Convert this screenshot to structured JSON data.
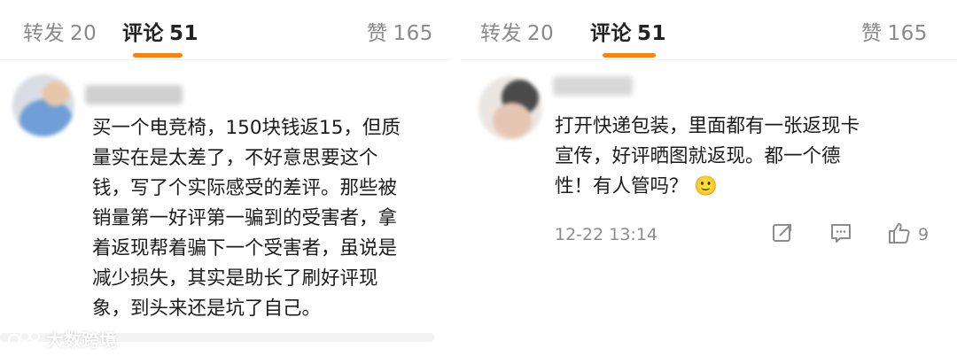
{
  "tabs": [
    {
      "label": "转发",
      "count": "20"
    },
    {
      "label": "评论",
      "count": "51"
    },
    {
      "label": "赞",
      "count": "165"
    }
  ],
  "accent_color": "#ff8200",
  "comments": [
    {
      "lines": [
        "买一个电竞椅，150块钱返15，但质",
        "量实在是太差了，不好意思要这个",
        "钱，写了个实际感受的差评。那些被",
        "销量第一好评第一骗到的受害者，拿",
        "着返现帮着骗下一个受害者，虽说是",
        "减少损失，其实是助长了刷好评现",
        "象，到头来还是坑了自己。"
      ]
    },
    {
      "lines": [
        "打开快递包装，里面都有一张返现卡",
        "宣传，好评晒图就返现。都一个德",
        "性！有人管吗？"
      ],
      "emoji": "🙂",
      "timestamp": "12-22 13:14",
      "like_count": "9",
      "icons": [
        "share-icon",
        "comment-icon",
        "like-icon"
      ]
    }
  ],
  "watermark": "大数跨境"
}
